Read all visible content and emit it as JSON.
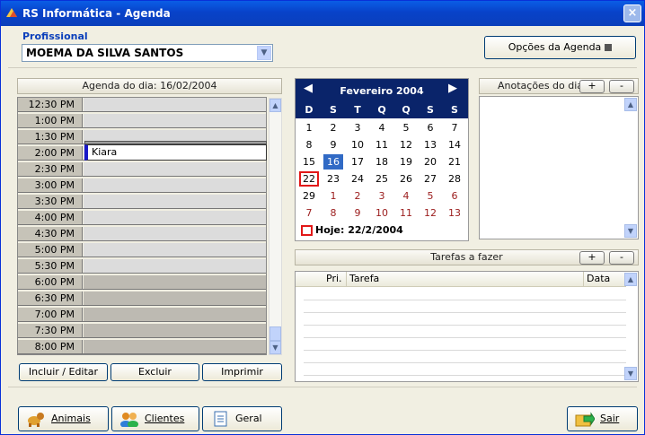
{
  "window": {
    "title": "RS Informática - Agenda",
    "close_label": "×"
  },
  "profissional": {
    "label": "Profissional",
    "value": "MOEMA DA SILVA SANTOS"
  },
  "opcoes_button": "Opções da Agenda",
  "agenda": {
    "header": "Agenda do dia: 16/02/2004",
    "slots": [
      "12:30 PM",
      "1:00 PM",
      "1:30 PM",
      "2:00 PM",
      "2:30 PM",
      "3:00 PM",
      "3:30 PM",
      "4:00 PM",
      "4:30 PM",
      "5:00 PM",
      "5:30 PM",
      "6:00 PM",
      "6:30 PM",
      "7:00 PM",
      "7:30 PM",
      "8:00 PM"
    ],
    "appointment": "Kiara",
    "buttons": {
      "incluir": "Incluir / Editar",
      "excluir": "Excluir",
      "imprimir": "Imprimir"
    }
  },
  "calendar": {
    "month": "Fevereiro 2004",
    "prev": "◀",
    "next": "▶",
    "dow": [
      "D",
      "S",
      "T",
      "Q",
      "Q",
      "S",
      "S"
    ],
    "weeks": [
      [
        "1",
        "2",
        "3",
        "4",
        "5",
        "6",
        "7"
      ],
      [
        "8",
        "9",
        "10",
        "11",
        "12",
        "13",
        "14"
      ],
      [
        "15",
        "16",
        "17",
        "18",
        "19",
        "20",
        "21"
      ],
      [
        "22",
        "23",
        "24",
        "25",
        "26",
        "27",
        "28"
      ],
      [
        "29",
        "1",
        "2",
        "3",
        "4",
        "5",
        "6"
      ],
      [
        "7",
        "8",
        "9",
        "10",
        "11",
        "12",
        "13"
      ]
    ],
    "selected": "16",
    "today": "22",
    "hoje_label": "Hoje: 22/2/2004"
  },
  "notes": {
    "header": "Anotações do dia",
    "add": "+",
    "remove": "-"
  },
  "tasks": {
    "header": "Tarefas a fazer",
    "add": "+",
    "remove": "-",
    "columns": {
      "pri": "Pri.",
      "tarefa": "Tarefa",
      "data": "Data"
    }
  },
  "footer": {
    "animais": "Animais",
    "clientes": "Clientes",
    "geral": "Geral",
    "sair": "Sair"
  },
  "colors": {
    "title_bar": "#0842c9",
    "selected_day": "#316ac5",
    "today_marker": "#e21818"
  }
}
